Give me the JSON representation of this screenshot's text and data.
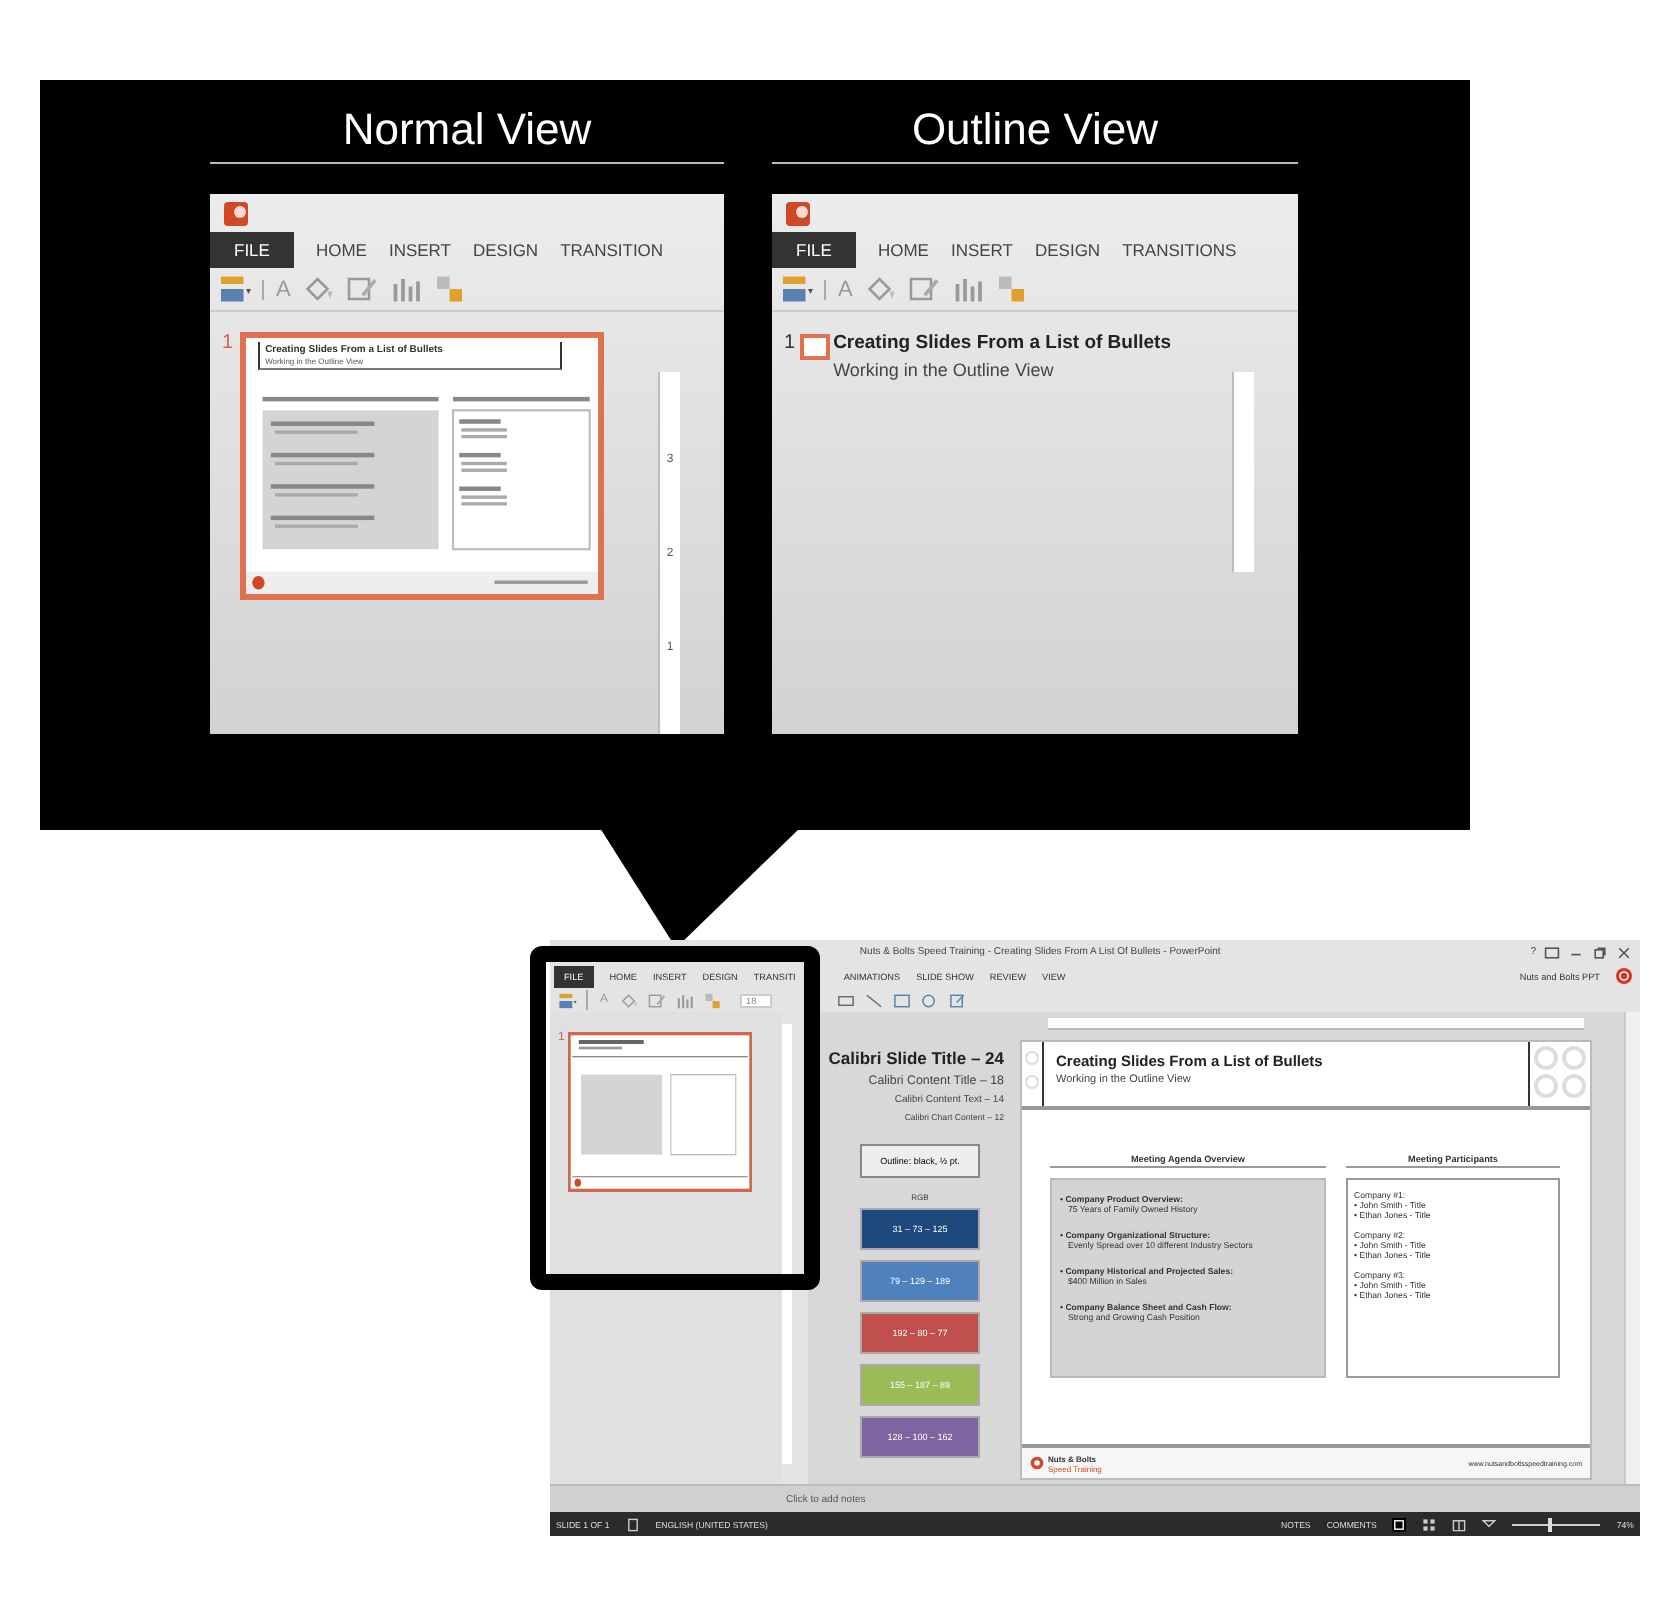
{
  "callout": {
    "views": [
      {
        "kind": "normal",
        "heading": "Normal View",
        "tabs": [
          {
            "label": "FILE",
            "selected": true
          },
          {
            "label": "HOME",
            "selected": false
          },
          {
            "label": "INSERT",
            "selected": false
          },
          {
            "label": "DESIGN",
            "selected": false
          },
          {
            "label": "TRANSITION",
            "selected": false
          }
        ],
        "toolbar_glyph": "A",
        "slide_number": "1",
        "thumbnail": {
          "title": "Creating Slides From a List of Bullets",
          "subtitle": "Working in the Outline View"
        },
        "ruler_numbers": [
          "3",
          "2",
          "1"
        ]
      },
      {
        "kind": "outline",
        "heading": "Outline View",
        "tabs": [
          {
            "label": "FILE",
            "selected": true
          },
          {
            "label": "HOME",
            "selected": false
          },
          {
            "label": "INSERT",
            "selected": false
          },
          {
            "label": "DESIGN",
            "selected": false
          },
          {
            "label": "TRANSITIONS",
            "selected": false
          }
        ],
        "toolbar_glyph": "A",
        "slide_number": "1",
        "outline": {
          "title": "Creating Slides From a List of Bullets",
          "subtitle": "Working in the Outline View"
        }
      }
    ]
  },
  "window": {
    "title": "Nuts & Bolts Speed Training - Creating Slides From A List Of Bullets - PowerPoint",
    "help": "?",
    "tabs": [
      {
        "label": "FILE",
        "selected": true
      },
      {
        "label": "HOME",
        "selected": false
      },
      {
        "label": "INSERT",
        "selected": false
      },
      {
        "label": "DESIGN",
        "selected": false
      },
      {
        "label": "TRANSITI",
        "selected": false
      },
      {
        "label": "ANIMATIONS",
        "selected": false
      },
      {
        "label": "SLIDE SHOW",
        "selected": false
      },
      {
        "label": "REVIEW",
        "selected": false
      },
      {
        "label": "VIEW",
        "selected": false
      }
    ],
    "account": "Nuts and Bolts PPT",
    "toolbar_glyph": "A",
    "font_size": "18",
    "slide_number": "1",
    "style_notes": {
      "lines": [
        {
          "kind": "slide_title",
          "text": "Calibri  Slide Title – 24"
        },
        {
          "kind": "content_title",
          "text": "Calibri Content Title – 18"
        },
        {
          "kind": "content_text",
          "text": "Calibri  Content  Text – 14"
        },
        {
          "kind": "chart_content",
          "text": "Calibri Chart  Content – 12"
        }
      ],
      "outline_note": "Outline: black, ½ pt.",
      "rgb_label": "RGB",
      "swatches": [
        {
          "label": "31 – 73 – 125",
          "color": "#1f497d"
        },
        {
          "label": "79 – 129 – 189",
          "color": "#4f81bd"
        },
        {
          "label": "192 – 80 – 77",
          "color": "#c0504d"
        },
        {
          "label": "155 – 187 – 89",
          "color": "#9bbb59"
        },
        {
          "label": "128 – 100 – 162",
          "color": "#8064a2"
        }
      ]
    },
    "slide": {
      "title": "Creating Slides From a List of Bullets",
      "subtitle": "Working in the Outline View",
      "agenda": {
        "heading": "Meeting Agenda Overview",
        "items": [
          {
            "label": "• Company Product Overview:",
            "text": "75 Years of Family Owned History"
          },
          {
            "label": "• Company Organizational Structure:",
            "text": "Evenly Spread over 10 different Industry Sectors"
          },
          {
            "label": "• Company Historical and Projected Sales:",
            "text": "$400 Million in Sales"
          },
          {
            "label": "• Company Balance Sheet and Cash Flow:",
            "text": "Strong and Growing Cash Position"
          }
        ]
      },
      "participants": {
        "heading": "Meeting Participants",
        "companies": [
          {
            "name": "Company #1:",
            "people": [
              "• John Smith - Title",
              "• Ethan Jones - Title"
            ]
          },
          {
            "name": "Company #2:",
            "people": [
              "• John Smith - Title",
              "• Ethan Jones - Title"
            ]
          },
          {
            "name": "Company #3:",
            "people": [
              "• John Smith - Title",
              "• Ethan Jones - Title"
            ]
          }
        ]
      },
      "footer": {
        "brand": "Nuts & Bolts",
        "tagline": "Speed Training",
        "url": "www.nutsandboltsspeedtraining.com"
      }
    },
    "notes_placeholder": "Click to add notes",
    "status_bar": {
      "slide": "SLIDE 1 OF 1",
      "language": "ENGLISH (UNITED STATES)",
      "notes": "NOTES",
      "comments": "COMMENTS",
      "zoom": "74%",
      "level": 0.4
    }
  }
}
